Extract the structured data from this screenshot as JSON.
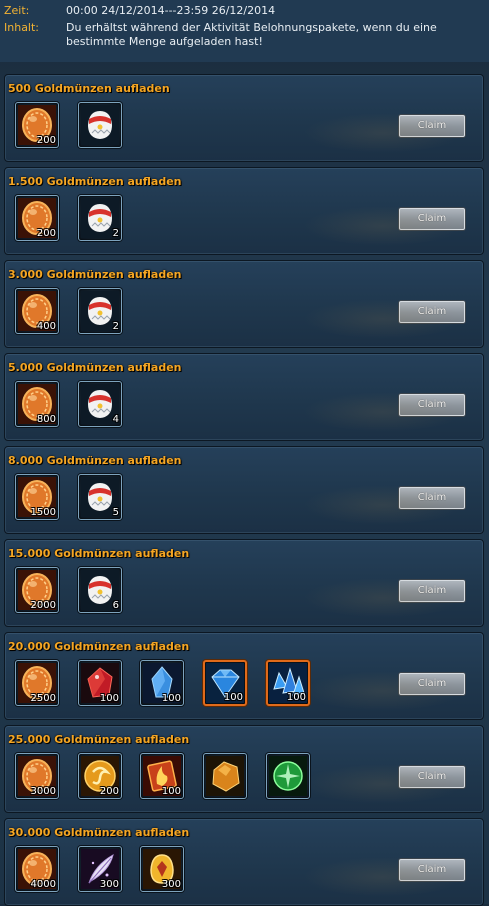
{
  "header": {
    "time_label": "Zeit:",
    "time_value": "00:00 24/12/2014---23:59 26/12/2014",
    "content_label": "Inhalt:",
    "content_line1": "Du erhältst während der Aktivität Belohnungspakete, wenn du eine",
    "content_line2": "bestimmte Menge aufgeladen hast!"
  },
  "claim_label": "Claim",
  "tiers": [
    {
      "title": "500 Goldmünzen aufladen",
      "items": [
        {
          "icon": "gold-coin-icon",
          "qty": "200"
        },
        {
          "icon": "egg-icon",
          "qty": ""
        }
      ]
    },
    {
      "title": "1.500 Goldmünzen aufladen",
      "items": [
        {
          "icon": "gold-coin-icon",
          "qty": "200"
        },
        {
          "icon": "egg-icon",
          "qty": "2"
        }
      ]
    },
    {
      "title": "3.000 Goldmünzen aufladen",
      "items": [
        {
          "icon": "gold-coin-icon",
          "qty": "400"
        },
        {
          "icon": "egg-icon",
          "qty": "2"
        }
      ]
    },
    {
      "title": "5.000 Goldmünzen aufladen",
      "items": [
        {
          "icon": "gold-coin-icon",
          "qty": "800"
        },
        {
          "icon": "egg-icon",
          "qty": "4"
        }
      ]
    },
    {
      "title": "8.000 Goldmünzen aufladen",
      "items": [
        {
          "icon": "gold-coin-icon",
          "qty": "1500"
        },
        {
          "icon": "egg-icon",
          "qty": "5"
        }
      ]
    },
    {
      "title": "15.000 Goldmünzen aufladen",
      "items": [
        {
          "icon": "gold-coin-icon",
          "qty": "2000"
        },
        {
          "icon": "egg-icon",
          "qty": "6"
        }
      ]
    },
    {
      "title": "20.000 Goldmünzen aufladen",
      "items": [
        {
          "icon": "gold-coin-icon",
          "qty": "2500"
        },
        {
          "icon": "red-gem-icon",
          "qty": "100"
        },
        {
          "icon": "blue-crystal-icon",
          "qty": "100"
        },
        {
          "icon": "blue-diamond-icon",
          "qty": "100",
          "rare": true
        },
        {
          "icon": "blue-crystal-cluster-icon",
          "qty": "100",
          "rare": true
        }
      ]
    },
    {
      "title": "25.000 Goldmünzen aufladen",
      "items": [
        {
          "icon": "gold-coin-icon",
          "qty": "3000"
        },
        {
          "icon": "gold-token-icon",
          "qty": "200"
        },
        {
          "icon": "fire-scroll-icon",
          "qty": "100"
        },
        {
          "icon": "amber-stone-icon",
          "qty": ""
        },
        {
          "icon": "green-orb-icon",
          "qty": ""
        }
      ]
    },
    {
      "title": "30.000 Goldmünzen aufladen",
      "items": [
        {
          "icon": "gold-coin-icon",
          "qty": "4000"
        },
        {
          "icon": "feather-icon",
          "qty": "300"
        },
        {
          "icon": "golden-egg-icon",
          "qty": "300"
        }
      ]
    }
  ]
}
